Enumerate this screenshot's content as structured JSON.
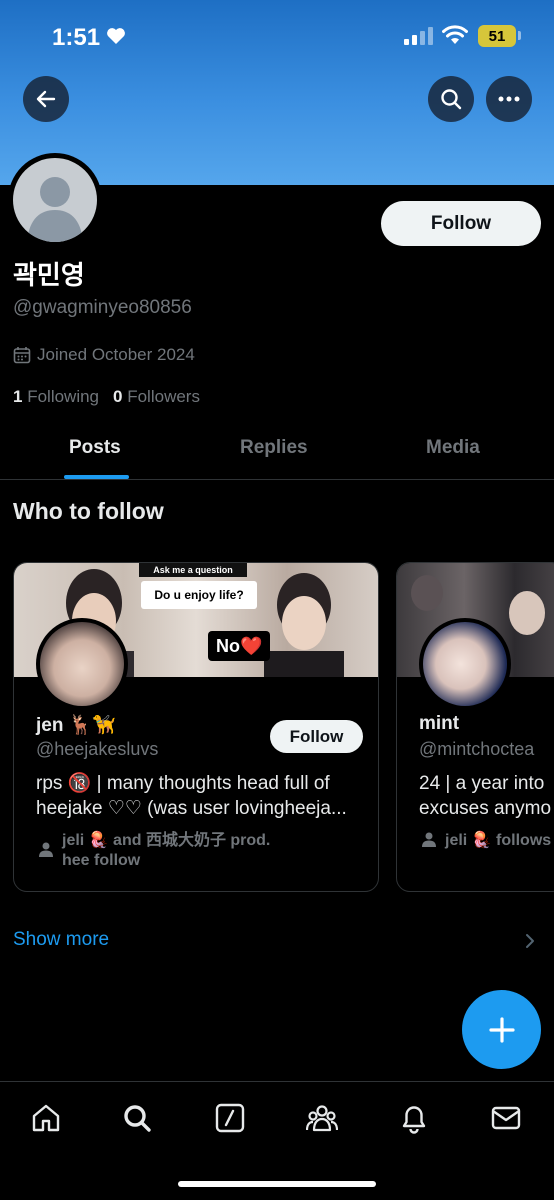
{
  "status_bar": {
    "time": "1:51",
    "battery": "51"
  },
  "header": {
    "back_icon": "arrow-left-icon",
    "search_icon": "search-icon",
    "more_icon": "more-horizontal-icon"
  },
  "profile": {
    "name": "곽민영",
    "handle": "@gwagminyeo80856",
    "joined": "Joined October 2024",
    "following_count": "1",
    "following_label": "Following",
    "followers_count": "0",
    "followers_label": "Followers",
    "follow_label": "Follow"
  },
  "tabs": [
    {
      "label": "Posts",
      "active": true
    },
    {
      "label": "Replies",
      "active": false
    },
    {
      "label": "Media",
      "active": false
    }
  ],
  "who_to_follow": {
    "title": "Who to follow",
    "cards": [
      {
        "cover_caption_small": "Ask me a question",
        "cover_caption_big": "Do u enjoy life?",
        "cover_sticker": "No❤️",
        "name": "jen 🦌🦮",
        "handle": "@heejakesluvs",
        "follow_label": "Follow",
        "bio_line1": "rps 🔞 | many thoughts head full of",
        "bio_line2": "heejake ♡♡ (was user lovingheeja...",
        "followed_by_line1": "jeli 🪼 and 西城大奶子 prod.",
        "followed_by_line2": "hee follow"
      },
      {
        "name": "mint",
        "handle": "@mintchoctea",
        "bio_line1": "24 | a year into",
        "bio_line2": "excuses anymo",
        "followed_by_line1": "jeli 🪼 follows"
      }
    ],
    "show_more": "Show more"
  },
  "fab": {
    "icon": "plus-icon"
  },
  "bottom_nav": [
    "home-icon",
    "search-icon",
    "grok-icon",
    "communities-icon",
    "notifications-icon",
    "messages-icon"
  ],
  "colors": {
    "accent": "#1d9bf0",
    "banner": "#3b8fe0",
    "muted": "#71767b",
    "background": "#000000"
  }
}
